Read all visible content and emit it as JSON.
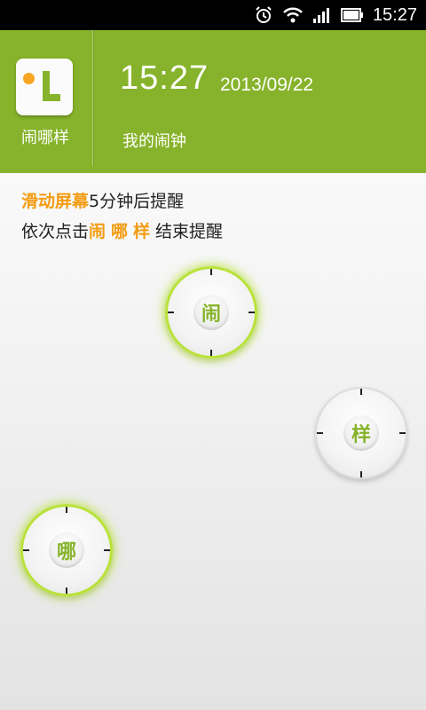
{
  "status_bar": {
    "time": "15:27",
    "icons": [
      "alarm-icon",
      "wifi-icon",
      "signal-icon",
      "battery-icon"
    ]
  },
  "app": {
    "name": "闹哪样",
    "accent_color": "#86b32b",
    "highlight_color": "#f39c12"
  },
  "alarm": {
    "time": "15:27",
    "date": "2013/09/22",
    "label": "我的闹钟"
  },
  "instructions": {
    "line1_highlight": "滑动屏幕",
    "line1_rest": "5分钟后提醒",
    "line2_prefix": "依次点击",
    "line2_highlight": "闹哪样",
    "line2_suffix": "结束提醒"
  },
  "dials": [
    {
      "char": "闹"
    },
    {
      "char": "样"
    },
    {
      "char": "哪"
    }
  ]
}
